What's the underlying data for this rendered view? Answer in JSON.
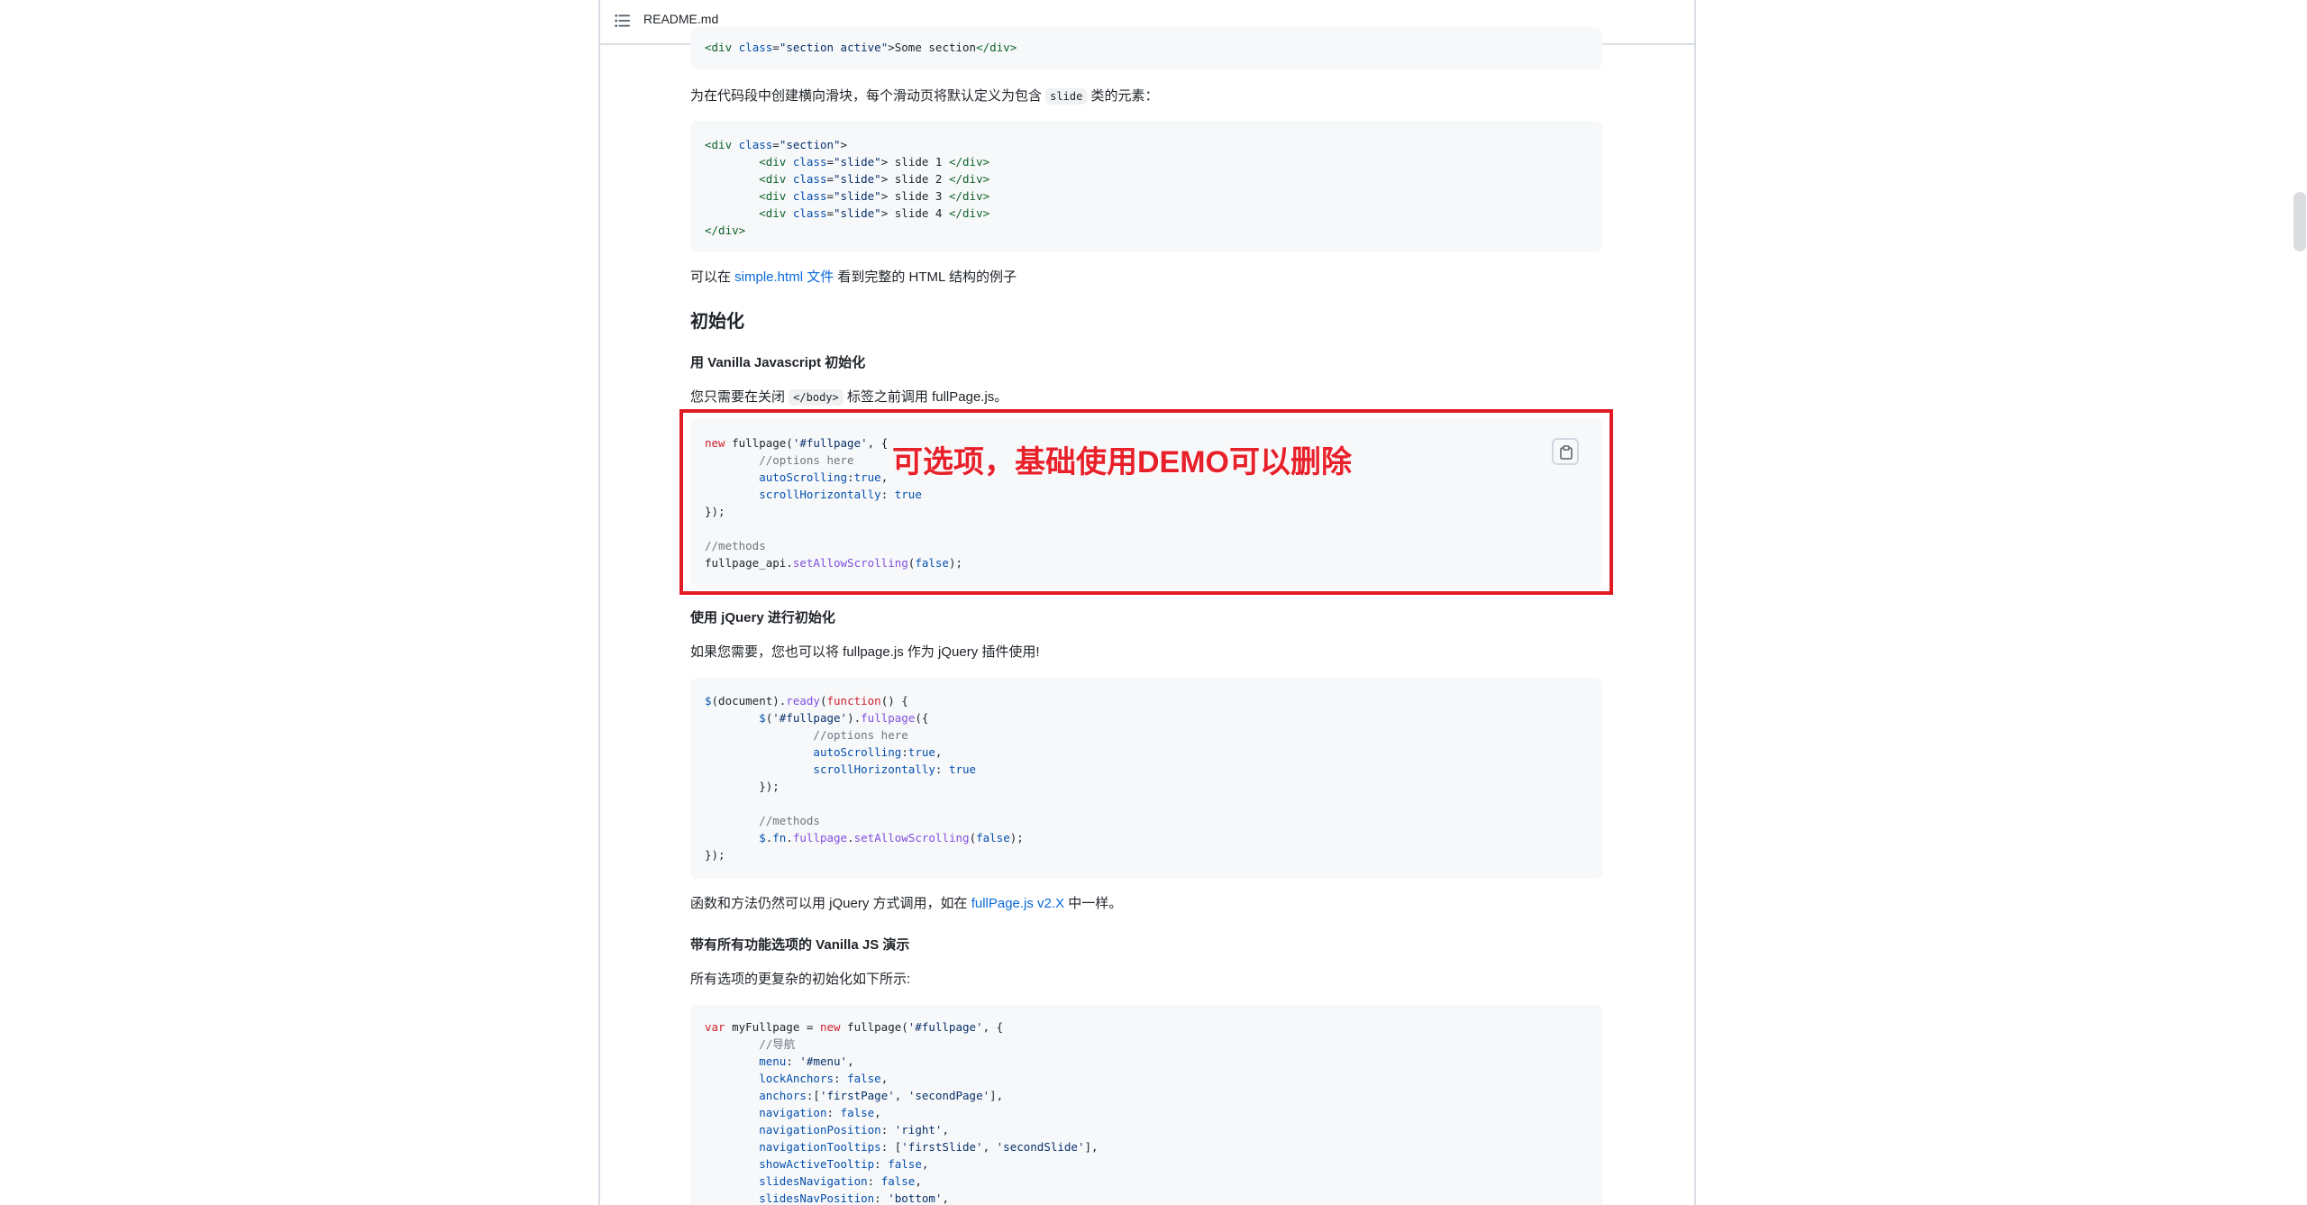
{
  "header": {
    "file_name": "README.md"
  },
  "blocks": {
    "code0": {
      "line": "<div class=\"section active\">Some section</div>"
    },
    "p1": {
      "before": "为在代码段中创建横向滑块，每个滑动页将默认定义为包含 ",
      "code": "slide",
      "after": " 类的元素："
    },
    "p2": {
      "before": "可以在 ",
      "link": "simple.html 文件",
      "after": " 看到完整的 HTML 结构的例子"
    },
    "h_init": "初始化",
    "h_vanilla": "用 Vanilla Javascript 初始化",
    "p3": {
      "before": "您只需要在关闭 ",
      "code": "</body>",
      "after": " 标签之前调用 fullPage.js。"
    },
    "h_jquery": "使用 jQuery 进行初始化",
    "p4": "如果您需要，您也可以将 fullpage.js 作为 jQuery 插件使用!",
    "p5": {
      "before": "函数和方法仍然可以用 jQuery 方式调用，如在 ",
      "link": "fullPage.js v2.X",
      "after": " 中一样。"
    },
    "h_demo": "带有所有功能选项的 Vanilla JS 演示",
    "p6": "所有选项的更复杂的初始化如下所示:"
  },
  "annotation": {
    "text": "可选项，基础使用DEMO可以删除",
    "color": "#e8202a"
  },
  "colors": {
    "keyword": "#cf222e",
    "string": "#0a3069",
    "function": "#8250df",
    "comment": "#6e7781",
    "tag": "#116329",
    "attr": "#0550ae",
    "link": "#0969da",
    "highlight": "#e01b24"
  },
  "icons": [
    "toc-list-icon",
    "copy-icon"
  ]
}
